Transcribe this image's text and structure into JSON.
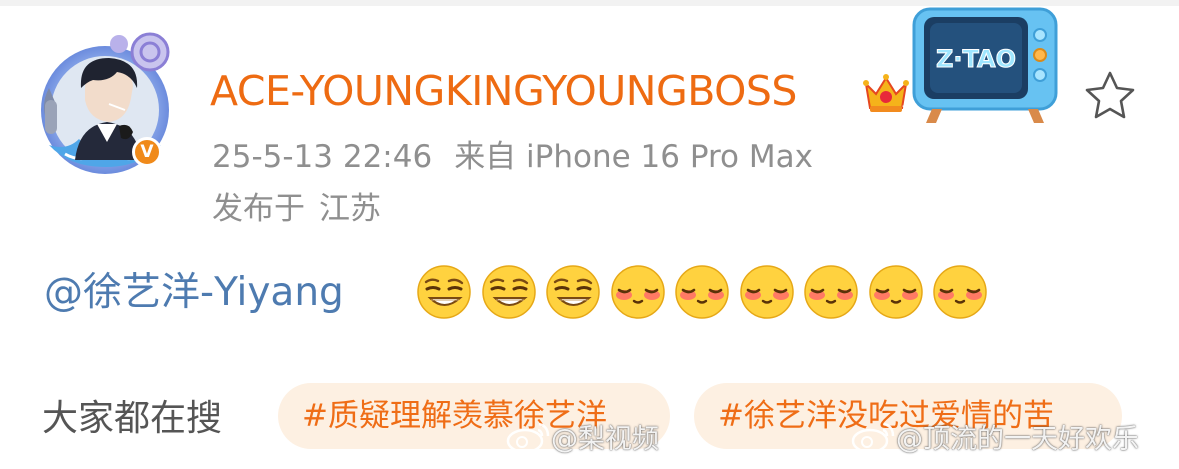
{
  "post": {
    "author": {
      "name": "ACE-YOUNGKINGYOUNGBOSS",
      "verified_badge": "V",
      "avatar_icon": "avatar-portrait-with-ornate-frame",
      "vip_icon": "crown-vip-icon"
    },
    "fan_badge": {
      "text": "Z·TAO",
      "icon": "tv-badge-icon"
    },
    "favorite_icon": "star-outline-icon",
    "timestamp": "25-5-13 22:46",
    "source": "来自 iPhone 16 Pro Max",
    "location_prefix": "发布于",
    "location": "江苏",
    "content": {
      "mention": "@徐艺洋-Yiyang",
      "emojis": [
        "smirk",
        "smirk",
        "smirk",
        "shy",
        "shy",
        "shy",
        "shy",
        "shy",
        "shy"
      ]
    }
  },
  "trending": {
    "label": "大家都在搜",
    "topics": [
      "#质疑理解羡慕徐艺洋",
      "#徐艺洋没吃过爱情的苦"
    ]
  },
  "watermarks": [
    "@梨视频",
    "@顶流的一天好欢乐"
  ],
  "colors": {
    "username": "#ee6b12",
    "mention": "#4e7bb0",
    "meta": "#8f8f8f",
    "chip_bg": "#fdf0e2",
    "chip_text": "#ef6d16",
    "verified": "#f08a1a"
  }
}
